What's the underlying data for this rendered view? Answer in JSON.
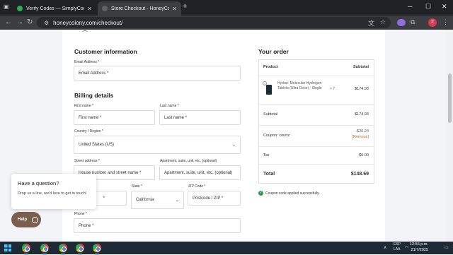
{
  "browser": {
    "tabs": [
      {
        "title": "Verify Codes — SimplyCodes",
        "active": false
      },
      {
        "title": "Store Checkout - HoneyColony",
        "active": true
      }
    ],
    "new_tab": "+",
    "url": "honeycolony.com/checkout/",
    "profile_initial": "2"
  },
  "checkout": {
    "customer_heading": "Customer information",
    "email_label": "Email Address *",
    "email_placeholder": "Email Address  *",
    "billing_heading": "Billing details",
    "first_name_label": "First name *",
    "first_name_placeholder": "First name *",
    "last_name_label": "Last name *",
    "last_name_placeholder": "Last name *",
    "country_label": "Country / Region *",
    "country_value": "United States (US)",
    "street_label": "Street address *",
    "street_placeholder": "House number and street name *",
    "apt_label": "Apartment, suite, unit, etc. (optional)",
    "apt_placeholder": "Apartment, suite, unit, etc. (optional)",
    "city_placeholder": "*",
    "state_label": "State *",
    "state_value": "California",
    "zip_label": "ZIP Code *",
    "zip_placeholder": "Postcode / ZIP *",
    "phone_label": "Phone *",
    "phone_placeholder": "Phone *"
  },
  "order": {
    "heading": "Your order",
    "col_product": "Product",
    "col_subtotal": "Subtotal",
    "item_name": "Hydra+ Molecular Hydrogen Tablets (Ultra Dose) - Single",
    "item_qty": "× 7",
    "item_price": "$174.93",
    "subtotal_label": "Subtotal",
    "subtotal_value": "$174.93",
    "coupon_label": "Coupon: courtz",
    "coupon_amount": "-$26.24",
    "coupon_remove": "[Remove]",
    "tax_label": "Tax",
    "tax_value": "$0.00",
    "total_label": "Total",
    "total_value": "$148.69",
    "coupon_applied_msg": "Coupon code applied successfully."
  },
  "chat": {
    "title": "Have a question?",
    "body": "Drop us a line, we'd love to get in touch!",
    "help_label": "Help"
  },
  "taskbar": {
    "lang": "ESP\nLAA",
    "time": "12:56 p.m.",
    "date": "21/7/2025"
  },
  "colors": {
    "accent_brown": "#7b5f4e",
    "success_green": "#2e9c49",
    "coupon_remove": "#b76a24"
  }
}
